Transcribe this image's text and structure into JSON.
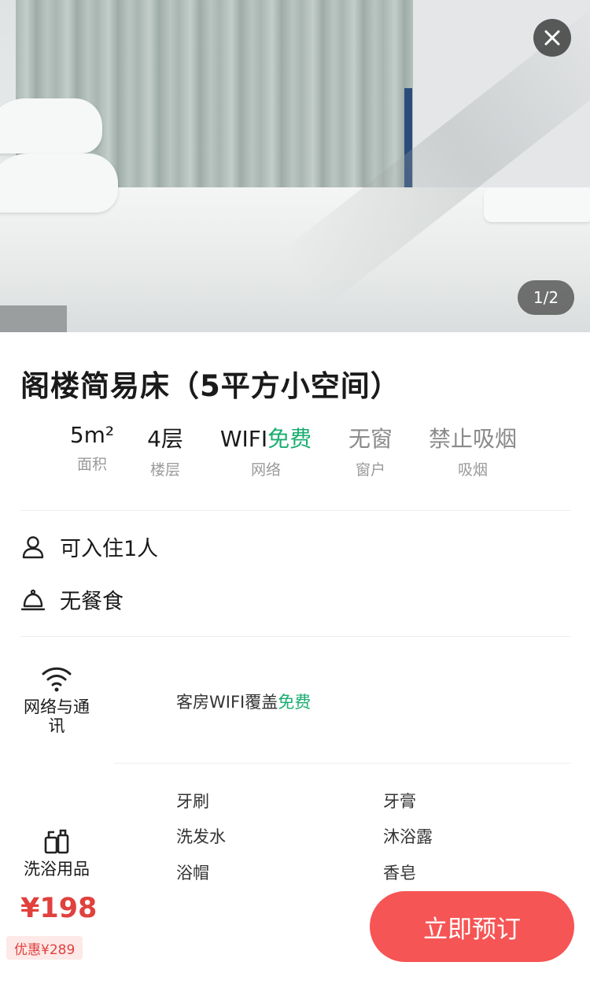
{
  "gallery": {
    "counter": "1/2"
  },
  "room": {
    "title": "阁楼简易床（5平方小空间）"
  },
  "stats": [
    {
      "value": "5m²",
      "label": "面积"
    },
    {
      "value": "4层",
      "label": "楼层"
    },
    {
      "value_prefix": "WIFI",
      "value_highlight": "免费",
      "label": "网络"
    },
    {
      "value": "无窗",
      "label": "窗户"
    },
    {
      "value": "禁止吸烟",
      "label": "吸烟"
    }
  ],
  "info": {
    "occupancy": "可入住1人",
    "meals": "无餐食"
  },
  "facilities": {
    "network": {
      "title": "网络与通讯",
      "desc_prefix": "客房WIFI覆盖",
      "desc_highlight": "免费"
    },
    "toiletries": {
      "title": "洗浴用品",
      "items": [
        "牙刷",
        "牙膏",
        "洗发水",
        "沐浴露",
        "浴帽",
        "香皂"
      ]
    }
  },
  "booking": {
    "price": "¥198",
    "discount": "优惠¥289",
    "button": "立即预订"
  },
  "colors": {
    "accent_red": "#f65555",
    "price_red": "#e0413d",
    "free_green": "#1aad70"
  },
  "icons": [
    "close-icon",
    "person-icon",
    "food-cover-icon",
    "wifi-icon",
    "toiletries-icon"
  ]
}
